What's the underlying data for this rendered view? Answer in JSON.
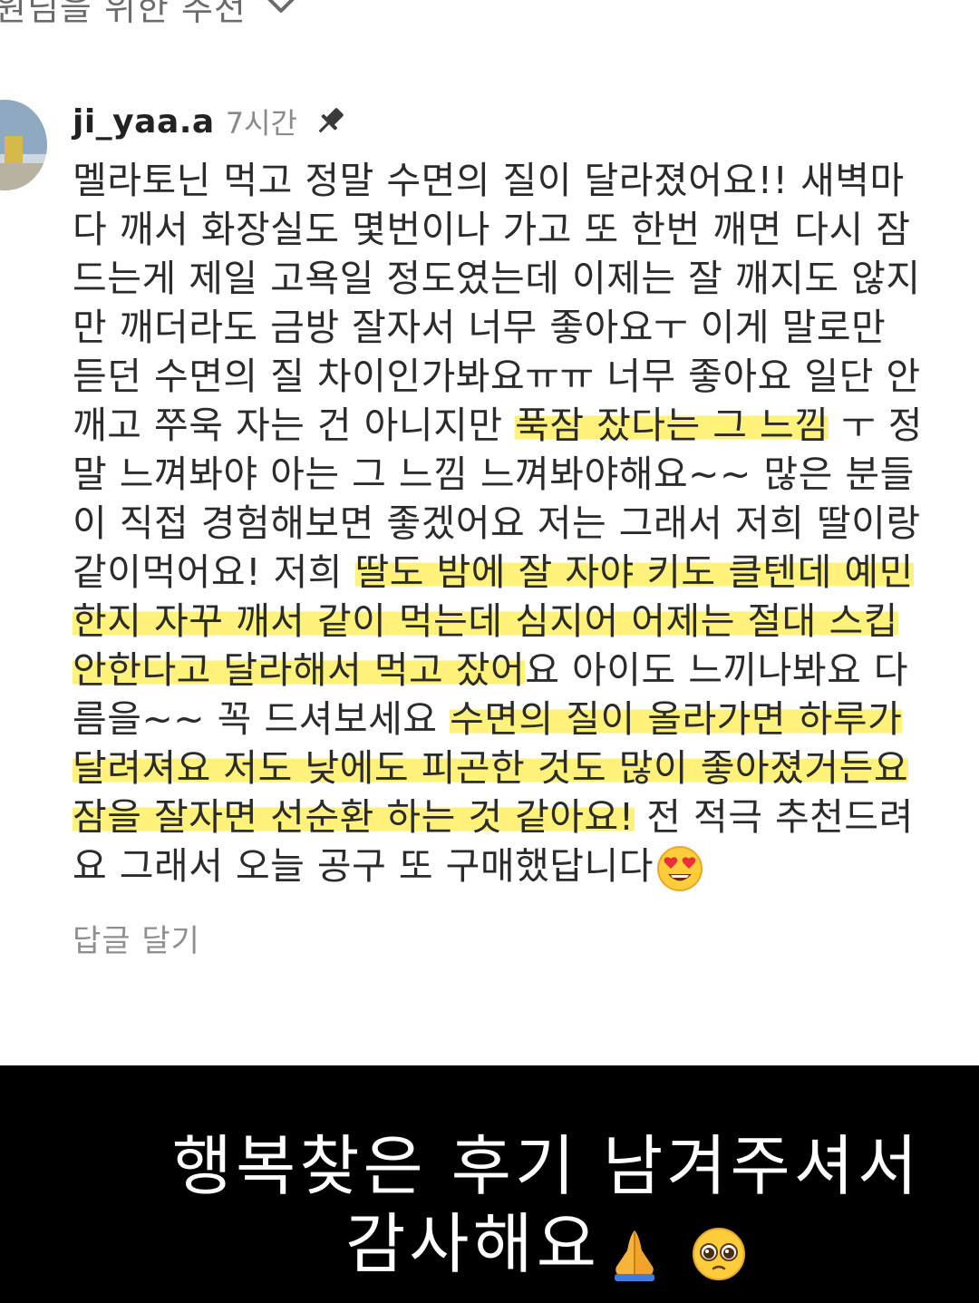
{
  "header": {
    "label": "원딤을 위한 추천"
  },
  "comment": {
    "username": "ji_yaa.a",
    "time": "7시간",
    "lines": [
      {
        "segments": [
          {
            "t": "멜라토닌 먹고 정말 수면의 질이 달라졌어요!! 새벽마",
            "hl": false
          }
        ]
      },
      {
        "segments": [
          {
            "t": "다 깨서 화장실도 몇번이나 가고 또 한번 깨면 다시 잠",
            "hl": false
          }
        ]
      },
      {
        "segments": [
          {
            "t": "드는게 제일 고욕일 정도였는데 이제는 잘 깨지도 않지",
            "hl": false
          }
        ]
      },
      {
        "segments": [
          {
            "t": "만 깨더라도 금방 잘자서 너무 좋아요ㅜ 이게 말로만",
            "hl": false
          }
        ]
      },
      {
        "segments": [
          {
            "t": "듣던 수면의 질 차이인가봐요ㅠㅠ 너무 좋아요 일단 안",
            "hl": false
          }
        ]
      },
      {
        "segments": [
          {
            "t": "깨고 쭈욱 자는 건 아니지만 ",
            "hl": false
          },
          {
            "t": "푹잠 잤다는 그 느낌",
            "hl": true
          },
          {
            "t": " ㅜ 정",
            "hl": false
          }
        ]
      },
      {
        "segments": [
          {
            "t": "말 느껴봐야 아는 그 느낌 느껴봐야해요~~ 많은 분들",
            "hl": false
          }
        ]
      },
      {
        "segments": [
          {
            "t": "이 직접 경험해보면 좋겠어요 저는 그래서 저희 딸이랑",
            "hl": false
          }
        ]
      },
      {
        "segments": [
          {
            "t": "같이먹어요! 저희 ",
            "hl": false
          },
          {
            "t": "딸도 밤에 잘 자야 키도 클텐데 예민",
            "hl": true
          }
        ]
      },
      {
        "segments": [
          {
            "t": "한지 자꾸 깨서 같이 먹는데 심지어 어제는 절대 스킵",
            "hl": true
          }
        ]
      },
      {
        "segments": [
          {
            "t": "안한다고 달라해서 먹고 잤어",
            "hl": true
          },
          {
            "t": "요 아이도 느끼나봐요 다",
            "hl": false
          }
        ]
      },
      {
        "segments": [
          {
            "t": "름을~~ 꼭 드셔보세요 ",
            "hl": false
          },
          {
            "t": "수면의 질이 올라가면 하루가",
            "hl": true
          }
        ]
      },
      {
        "segments": [
          {
            "t": "달려져요 저도 낮에도 피곤한 것도 많이 좋아졌거든요",
            "hl": true
          }
        ]
      },
      {
        "segments": [
          {
            "t": "잠을 잘자면 선순환 하는 것 같아요!",
            "hl": true
          },
          {
            "t": " 전 적극 추천드려",
            "hl": false
          }
        ]
      },
      {
        "segments": [
          {
            "t": "요 그래서 오늘 공구 또 구매했답니다",
            "hl": false
          }
        ]
      }
    ],
    "reply_label": "답글 달기"
  },
  "caption": {
    "line1": "행복찾은 후기 남겨주셔서",
    "line2": "감사해요"
  },
  "icons": {
    "chevron": "chevron-down-icon",
    "pin": "pin-icon",
    "heart_eyes": "heart-eyes-emoji-icon",
    "folded_hands": "folded-hands-emoji-icon",
    "pleading_face": "pleading-face-emoji-icon"
  },
  "colors": {
    "highlight": "#fff27a",
    "caption_bg": "#000000",
    "caption_text": "#ffffff"
  }
}
